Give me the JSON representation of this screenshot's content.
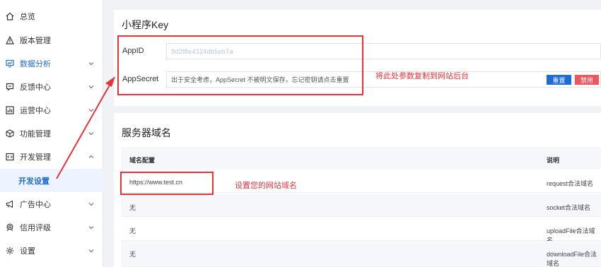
{
  "sidebar": {
    "items": [
      {
        "label": "总览",
        "icon": "home-icon",
        "chevron": false
      },
      {
        "label": "版本管理",
        "icon": "warning-triangle-icon",
        "chevron": false
      },
      {
        "label": "数据分析",
        "icon": "monitor-chart-icon",
        "chevron": true,
        "active": true
      },
      {
        "label": "反馈中心",
        "icon": "feedback-icon",
        "chevron": true
      },
      {
        "label": "运营中心",
        "icon": "bar-chart-icon",
        "chevron": true
      },
      {
        "label": "功能管理",
        "icon": "cube-icon",
        "chevron": true
      },
      {
        "label": "开发管理",
        "icon": "code-icon",
        "chevron": true,
        "expanded": true
      },
      {
        "label": "广告中心",
        "icon": "megaphone-icon",
        "chevron": true
      },
      {
        "label": "信用评级",
        "icon": "badge-icon",
        "chevron": true
      },
      {
        "label": "设置",
        "icon": "gear-icon",
        "chevron": true
      }
    ],
    "sub_item": "开发设置"
  },
  "key_card": {
    "title": "小程序Key",
    "appid_label": "AppID",
    "appid_value": "9d2f8e4324db5eb7a",
    "secret_label": "AppSecret",
    "secret_text": "出于安全考虑，AppSecret 不被明文保存，忘记密钥请点击重置",
    "reset_label": "重置",
    "disable_label": "禁用",
    "annotation": "将此处参数复制到网站后台"
  },
  "domain_card": {
    "title": "服务器域名",
    "columns": [
      "域名配置",
      "说明"
    ],
    "rows": [
      {
        "domain": "https://www.test.cn",
        "desc": "request合法域名"
      },
      {
        "domain": "无",
        "desc": "socket合法域名"
      },
      {
        "domain": "无",
        "desc": "uploadFile合法域名"
      },
      {
        "domain": "无",
        "desc": "downloadFile合法域名"
      }
    ],
    "annotation": "设置您的网站域名"
  },
  "colors": {
    "accent": "#1f6bd6",
    "danger": "#f2545e",
    "annotation": "#e8323a"
  }
}
